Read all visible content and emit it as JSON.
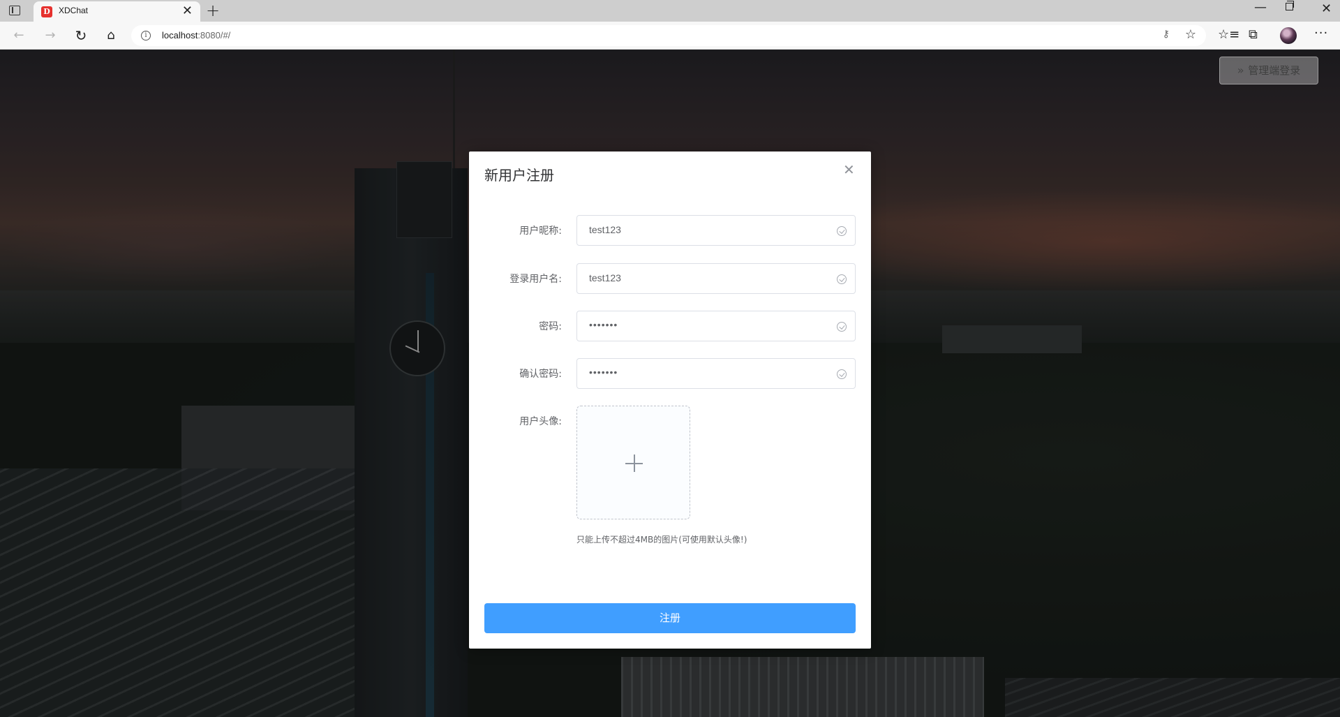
{
  "browser": {
    "tab_title": "XDChat",
    "tab_favicon_letter": "D",
    "url_host": "localhost",
    "url_rest": ":8080/#/",
    "icons": {
      "tab_menu": "tab-actions-icon",
      "close_tab": "close-icon",
      "new_tab": "plus-icon",
      "back": "arrow-left-icon",
      "forward": "arrow-right-icon",
      "reload": "reload-icon",
      "home": "home-icon",
      "site_info": "info-icon",
      "password": "key-icon",
      "add_favorite": "star-plus-icon",
      "favorites": "favorites-icon",
      "collections": "collections-icon",
      "profile": "profile-avatar",
      "more": "more-icon"
    },
    "glyphs": {
      "close": "✕",
      "new_tab": "+",
      "back": "←",
      "forward": "→",
      "reload": "↻",
      "home": "⌂",
      "info": "i",
      "key": "⚷",
      "add_favorite": "☆",
      "favorites": "☆≡",
      "collections": "⧉",
      "more": "···",
      "minimize": "—",
      "window_close": "✕"
    }
  },
  "page": {
    "admin_button": {
      "chevron": "»",
      "label": "管理端登录"
    }
  },
  "modal": {
    "title": "新用户注册",
    "close_glyph": "✕",
    "fields": [
      {
        "label": "用户昵称:",
        "value": "test123",
        "type": "text"
      },
      {
        "label": "登录用户名:",
        "value": "test123",
        "type": "text"
      },
      {
        "label": "密码:",
        "value": "•••••••",
        "type": "password"
      },
      {
        "label": "确认密码:",
        "value": "•••••••",
        "type": "password"
      }
    ],
    "avatar_label": "用户头像:",
    "upload_tip": "只能上传不超过4MB的图片(可使用默认头像!)",
    "submit_label": "注册"
  },
  "colors": {
    "primary": "#409eff",
    "favicon": "#e6312e",
    "input_border": "#dcdfe6",
    "label_text": "#606266"
  }
}
